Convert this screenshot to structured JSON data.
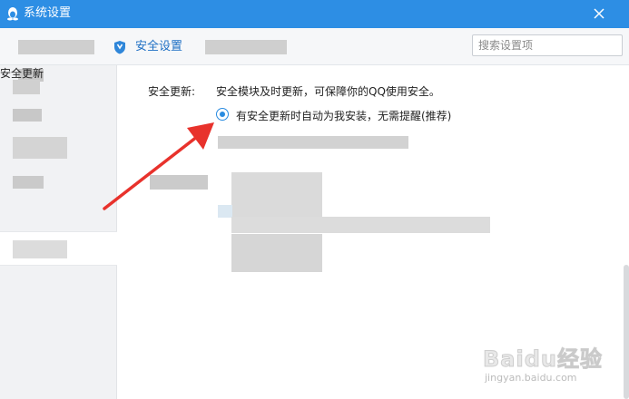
{
  "window": {
    "title": "系统设置",
    "brand_color": "#2d8ee4"
  },
  "tabs": {
    "active_label": "安全设置",
    "active_icon": "shield-icon"
  },
  "search": {
    "placeholder": "搜索设置项",
    "value": ""
  },
  "sidebar": {
    "selected_label": "安全更新"
  },
  "security_update": {
    "field_label": "安全更新:",
    "description": "安全模块及时更新，可保障你的QQ使用安全。",
    "option_label": "有安全更新时自动为我安装，无需提醒(推荐)",
    "option_selected": true
  },
  "watermark": {
    "brand": "Baidu经验",
    "url": "jingyan.baidu.com"
  }
}
